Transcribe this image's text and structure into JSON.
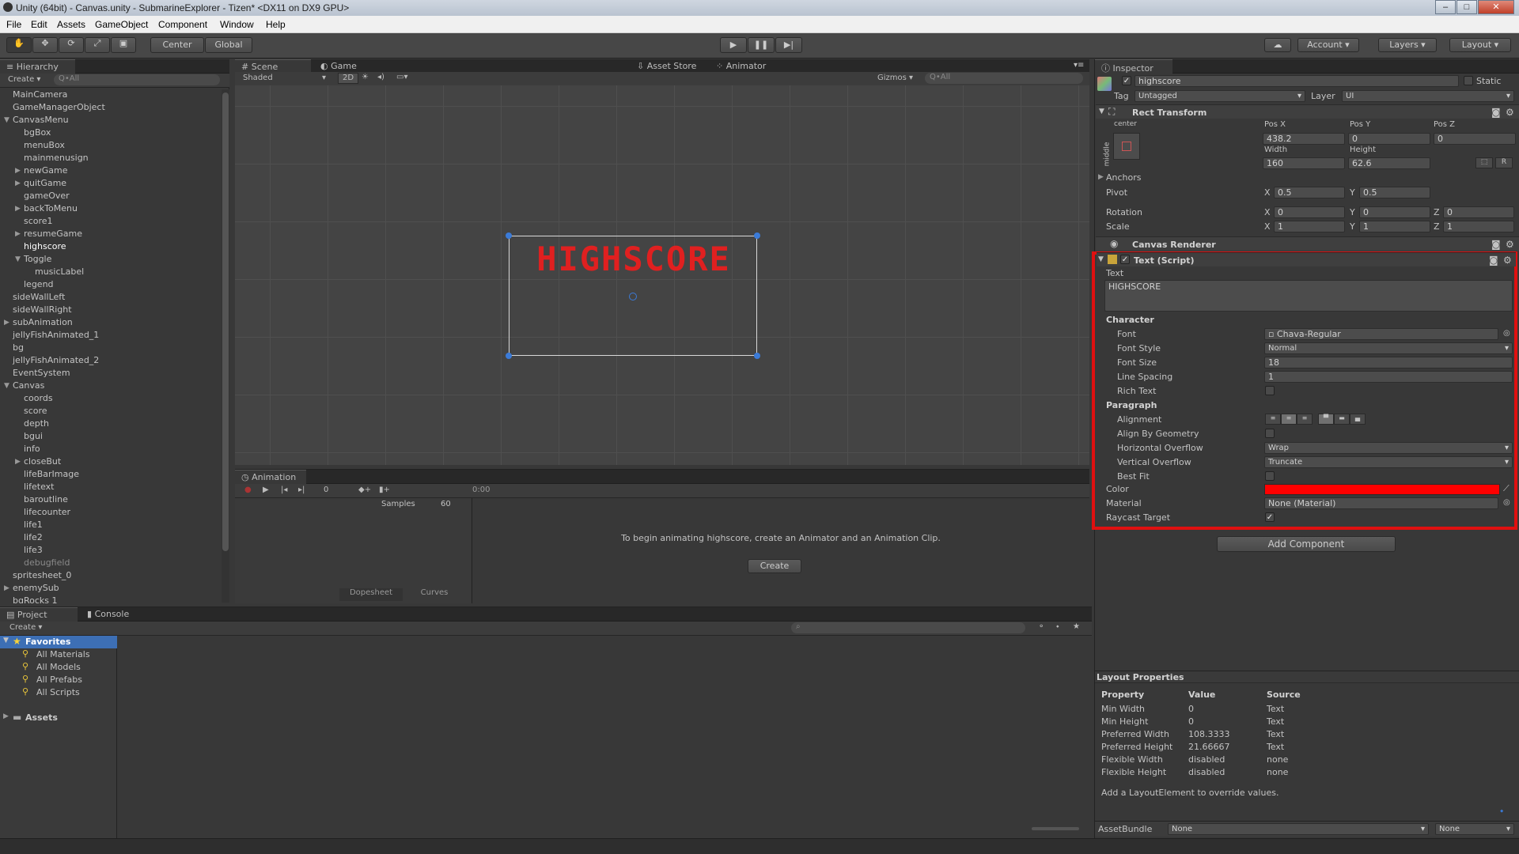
{
  "window": {
    "title": "Unity (64bit) - Canvas.unity - SubmarineExplorer - Tizen* <DX11 on DX9 GPU>"
  },
  "menu": [
    "File",
    "Edit",
    "Assets",
    "GameObject",
    "Component",
    "Window",
    "Help"
  ],
  "toolbar": {
    "pivot": "Center",
    "space": "Global",
    "account": "Account",
    "layers": "Layers",
    "layout": "Layout"
  },
  "hierarchy": {
    "tab": "Hierarchy",
    "create": "Create",
    "search": "Q•All",
    "items": [
      "MainCamera",
      "GameManagerObject",
      "CanvasMenu",
      "bgBox",
      "menuBox",
      "mainmenusign",
      "newGame",
      "quitGame",
      "gameOver",
      "backToMenu",
      "score1",
      "resumeGame",
      "highscore",
      "Toggle",
      "musicLabel",
      "legend",
      "sideWallLeft",
      "sideWallRight",
      "subAnimation",
      "jellyFishAnimated_1",
      "bg",
      "jellyFishAnimated_2",
      "EventSystem",
      "Canvas",
      "coords",
      "score",
      "depth",
      "bgui",
      "info",
      "closeBut",
      "lifeBarImage",
      "lifetext",
      "baroutline",
      "lifecounter",
      "life1",
      "life2",
      "life3",
      "debugfield",
      "spritesheet_0",
      "enemySub",
      "bgRocks 1"
    ]
  },
  "scene": {
    "tabs": [
      "Scene",
      "Game",
      "Asset Store",
      "Animator"
    ],
    "shading": "Shaded",
    "mode2d": "2D",
    "gizmos": "Gizmos",
    "search": "Q•All",
    "text": "HIGHSCORE"
  },
  "animation": {
    "tab": "Animation",
    "frame": "0",
    "time": "0:00",
    "samples_label": "Samples",
    "samples": "60",
    "message": "To begin animating highscore, create an Animator and an Animation Clip.",
    "create": "Create",
    "dopesheet": "Dopesheet",
    "curves": "Curves"
  },
  "project": {
    "tabs": [
      "Project",
      "Console"
    ],
    "create": "Create",
    "favorites": "Favorites",
    "favorite_items": [
      "All Materials",
      "All Models",
      "All Prefabs",
      "All Scripts"
    ],
    "assets": "Assets"
  },
  "inspector": {
    "tab": "Inspector",
    "name": "highscore",
    "static": "Static",
    "tag_label": "Tag",
    "tag": "Untagged",
    "layer_label": "Layer",
    "layer": "UI",
    "rect": {
      "title": "Rect Transform",
      "anchor_h": "center",
      "anchor_v": "middle",
      "posx_label": "Pos X",
      "posy_label": "Pos Y",
      "posz_label": "Pos Z",
      "posx": "438.2",
      "posy": "0",
      "posz": "0",
      "width_label": "Width",
      "height_label": "Height",
      "width": "160",
      "height": "62.6",
      "anchors": "Anchors",
      "pivot": "Pivot",
      "pivot_x": "0.5",
      "pivot_y": "0.5",
      "rotation": "Rotation",
      "rot_x": "0",
      "rot_y": "0",
      "rot_z": "0",
      "scale": "Scale",
      "scale_x": "1",
      "scale_y": "1",
      "scale_z": "1",
      "x": "X",
      "y": "Y",
      "z": "Z",
      "r": "R"
    },
    "canvas_renderer": "Canvas Renderer",
    "text_script": {
      "title": "Text (Script)",
      "text_label": "Text",
      "text": "HIGHSCORE",
      "character": "Character",
      "font_label": "Font",
      "font": "Chava-Regular",
      "font_style_label": "Font Style",
      "font_style": "Normal",
      "font_size_label": "Font Size",
      "font_size": "18",
      "line_spacing_label": "Line Spacing",
      "line_spacing": "1",
      "rich_text_label": "Rich Text",
      "paragraph": "Paragraph",
      "alignment_label": "Alignment",
      "align_geom_label": "Align By Geometry",
      "h_overflow_label": "Horizontal Overflow",
      "h_overflow": "Wrap",
      "v_overflow_label": "Vertical Overflow",
      "v_overflow": "Truncate",
      "best_fit_label": "Best Fit",
      "color_label": "Color",
      "color": "#ff0000",
      "material_label": "Material",
      "material": "None (Material)",
      "raycast_label": "Raycast Target"
    },
    "add_component": "Add Component",
    "layout_props": {
      "title": "Layout Properties",
      "headers": [
        "Property",
        "Value",
        "Source"
      ],
      "rows": [
        [
          "Min Width",
          "0",
          "Text"
        ],
        [
          "Min Height",
          "0",
          "Text"
        ],
        [
          "Preferred Width",
          "108.3333",
          "Text"
        ],
        [
          "Preferred Height",
          "21.66667",
          "Text"
        ],
        [
          "Flexible Width",
          "disabled",
          "none"
        ],
        [
          "Flexible Height",
          "disabled",
          "none"
        ]
      ],
      "note": "Add a LayoutElement to override values."
    },
    "assetbundle_label": "AssetBundle",
    "assetbundle": "None",
    "variant": "None"
  },
  "colors": {
    "highlight": "#e01010",
    "selection": "#3d6fb5",
    "scene_text": "#e02020"
  }
}
